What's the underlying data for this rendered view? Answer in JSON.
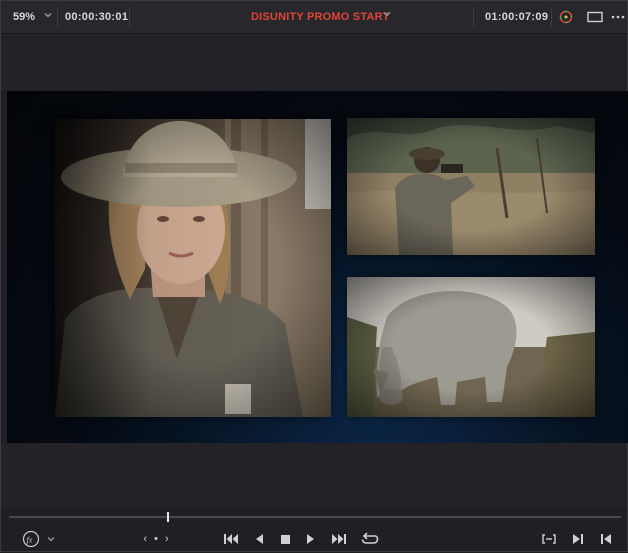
{
  "topbar": {
    "zoom": "59%",
    "source_timecode": "00:00:30:01",
    "project_title": "DISUNITY PROMO START",
    "record_timecode": "01:00:07:09"
  },
  "colors": {
    "accent_title": "#e0433a",
    "ui_background": "#202024",
    "canvas_glow": "#0d2a4e"
  },
  "icons": {
    "zoom_dropdown": "chevron-down-icon",
    "title_dropdown": "chevron-down-icon",
    "color_wheel": "color-wheel-icon",
    "viewer_mode": "viewer-mode-icon",
    "more": "more-options-icon",
    "fx": "fx-icon",
    "jump_start": "jump-to-start-icon",
    "step_back": "play-reverse-icon",
    "stop": "stop-icon",
    "play": "play-icon",
    "jump_end": "jump-to-end-icon",
    "loop": "loop-icon",
    "match_frame": "match-frame-icon",
    "mark_in": "mark-in-icon",
    "mark_out": "mark-out-icon"
  },
  "transport": {
    "nav_label": "‹ • ›"
  }
}
